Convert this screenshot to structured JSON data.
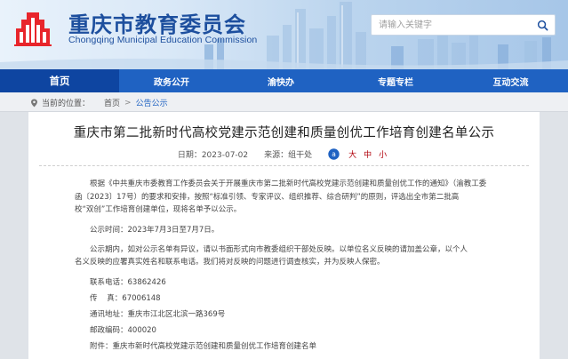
{
  "header": {
    "title": "重庆市教育委员会",
    "subtitle": "Chongqing Municipal Education Commission",
    "search": {
      "placeholder": "请输入关键字"
    },
    "brand_color": "#1d4f9e"
  },
  "nav": {
    "items": [
      {
        "label": "首页",
        "active": true
      },
      {
        "label": "政务公开"
      },
      {
        "label": "渝快办"
      },
      {
        "label": "专题专栏"
      },
      {
        "label": "互动交流"
      }
    ],
    "bar_color": "#1f62c2",
    "active_color": "#0e45a1"
  },
  "breadcrumb": {
    "label": "当前的位置：",
    "items": [
      "首页",
      "公告公示"
    ]
  },
  "article": {
    "title": "重庆市第二批新时代高校党建示范创建和质量创优工作培育创建名单公示",
    "date": "日期：2023-07-02",
    "source": "来源：组干处",
    "font_sizes": [
      "大",
      "中",
      "小"
    ],
    "paragraphs": [
      "根据《中共重庆市委教育工作委员会关于开展重庆市第二批新时代高校党建示范创建和质量创优工作的通知》（渝教工委",
      "函〔2023〕17号）的要求和安排，按照“标准引领、专家评议、组织推荐、综合研判”的原则，评选出全市第二批高",
      "校“双创”工作培育创建单位，现将名单予以公示。",
      "公示时间：2023年7月3日至7月7日。",
      "公示期内，如对公示名单有异议，请以书面形式向市教委组织干部处反映。以单位名义反映的请加盖公章，以个人",
      "名义反映的应署真实姓名和联系电话。我们将对反映的问题进行调查核实，并为反映人保密。",
      "联系电话：63862426",
      "传    真：67006148",
      "通讯地址：重庆市江北区北滨一路369号",
      "邮政编码：400020",
      "附件：重庆市新时代高校党建示范创建和质量创优工作培育创建名单"
    ]
  }
}
